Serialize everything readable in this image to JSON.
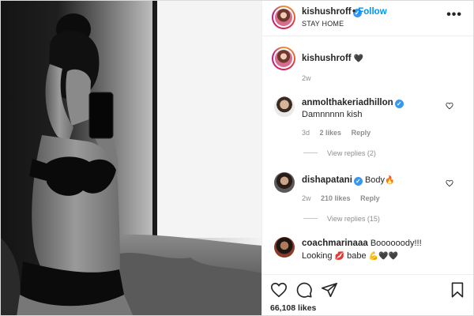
{
  "post": {
    "username": "kishushroff",
    "follow_label": "Follow",
    "location": "STAY HOME",
    "more_label": "•••"
  },
  "caption": {
    "username": "kishushroff",
    "emoji": "🖤",
    "time": "2w"
  },
  "comments": [
    {
      "username": "anmolthakeriadhillon",
      "verified": true,
      "text": "Damnnnnn kish",
      "time": "3d",
      "likes": "2 likes",
      "reply": "Reply",
      "view_replies": "View replies (2)"
    },
    {
      "username": "dishapatani",
      "verified": true,
      "text": "Body",
      "emoji": "🔥",
      "time": "2w",
      "likes": "210 likes",
      "reply": "Reply",
      "view_replies": "View replies (15)"
    },
    {
      "username": "coachmarinaaa",
      "verified": false,
      "text": "Boooooody!!!",
      "text_line2": "Looking",
      "emoji_a": "💋",
      "text_line2b": "babe",
      "emoji_b": "💪🖤🖤"
    }
  ],
  "footer": {
    "likes": "66,108 likes"
  },
  "colors": {
    "accent": "#0095f6",
    "verified": "#3897f0",
    "muted": "#8e8e8e",
    "text": "#262626"
  },
  "icons": {
    "like": "heart-outline-icon",
    "comment": "speech-bubble-icon",
    "share": "paper-plane-icon",
    "save": "bookmark-icon",
    "more": "three-dots-icon",
    "verified": "verified-badge-icon"
  }
}
